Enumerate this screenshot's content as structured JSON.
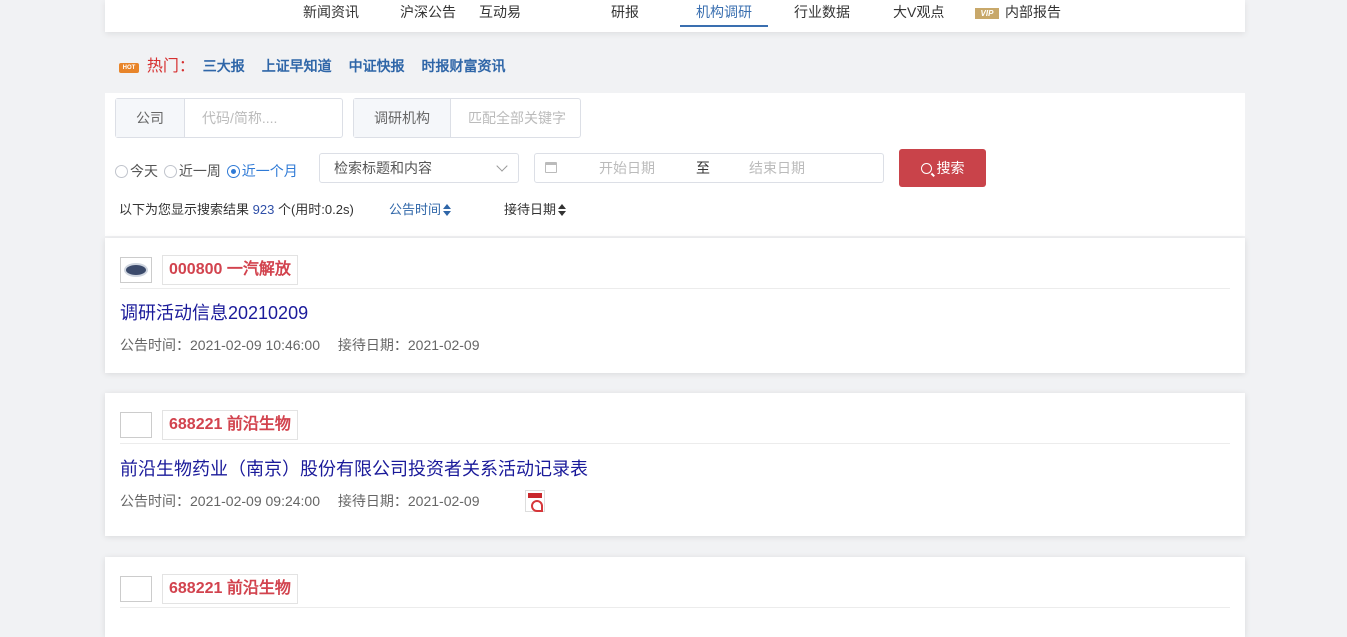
{
  "nav": {
    "items": [
      "新闻资讯",
      "沪深公告",
      "互动易",
      "研报",
      "机构调研",
      "行业数据",
      "大V观点",
      "内部报告"
    ],
    "active_index": 4,
    "vip_badge": "VIP"
  },
  "hot": {
    "icon": "HOT",
    "label": "热门：",
    "links": [
      "三大报",
      "上证早知道",
      "中证快报",
      "时报财富资讯"
    ]
  },
  "search": {
    "company_label": "公司",
    "company_placeholder": "代码/简称....",
    "org_label": "调研机构",
    "org_placeholder": "匹配全部关键字",
    "radios": [
      "今天",
      "近一周",
      "近一个月"
    ],
    "radio_checked_index": 2,
    "select_value": "检索标题和内容",
    "start_date_placeholder": "开始日期",
    "date_separator": "至",
    "end_date_placeholder": "结束日期",
    "button_label": "搜索"
  },
  "result_info": {
    "prefix": "以下为您显示搜索结果",
    "count": "923",
    "suffix": "个(用时:0.2s)",
    "sort_announce": "公告时间",
    "sort_reception": "接待日期"
  },
  "cards": [
    {
      "stock": "000800 一汽解放",
      "title": "调研活动信息20210209",
      "announce_label": "公告时间：",
      "announce_time": "2021-02-09 10:46:00",
      "reception_label": "接待日期：",
      "reception_date": "2021-02-09",
      "has_pdf": false
    },
    {
      "stock": "688221 前沿生物",
      "title": "前沿生物药业（南京）股份有限公司投资者关系活动记录表",
      "announce_label": "公告时间：",
      "announce_time": "2021-02-09 09:24:00",
      "reception_label": "接待日期：",
      "reception_date": "2021-02-09",
      "has_pdf": true
    },
    {
      "stock": "688221 前沿生物"
    }
  ],
  "colors": {
    "accent": "#3a6fb0",
    "stock": "#d2434e",
    "title": "#1a1a9a",
    "search_button": "#c9434a"
  }
}
